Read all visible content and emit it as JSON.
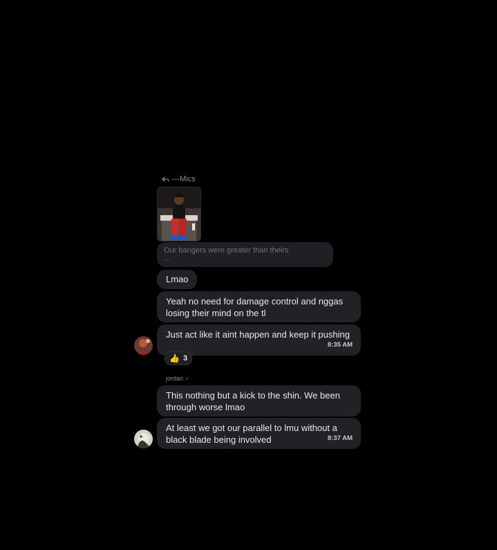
{
  "reply_ref": {
    "icon": "reply-icon",
    "name": "—Mics"
  },
  "photo": {
    "description_icon": "photo-thumbnail"
  },
  "quoted": {
    "line1": "Our bangers were greater than theirs",
    "line2": "..."
  },
  "messages": [
    {
      "text": "Lmao"
    },
    {
      "text": "Yeah no need for damage control and nggas losing their mind on the tl"
    },
    {
      "text": "Just act like it aint happen and keep it pushing",
      "time": "8:35 AM"
    }
  ],
  "reaction": {
    "emoji": "👍",
    "count": "3"
  },
  "second_group": {
    "sender": "jordan",
    "messages": [
      {
        "text": "This nothing but a kick to the shin. We been through worse lmao"
      },
      {
        "text": "At least we got our parallel to lmu without a black blade being involved",
        "time": "8:37 AM"
      }
    ]
  },
  "colors": {
    "background": "#000000",
    "bubble": "#212226",
    "text": "#e7e9ea"
  }
}
